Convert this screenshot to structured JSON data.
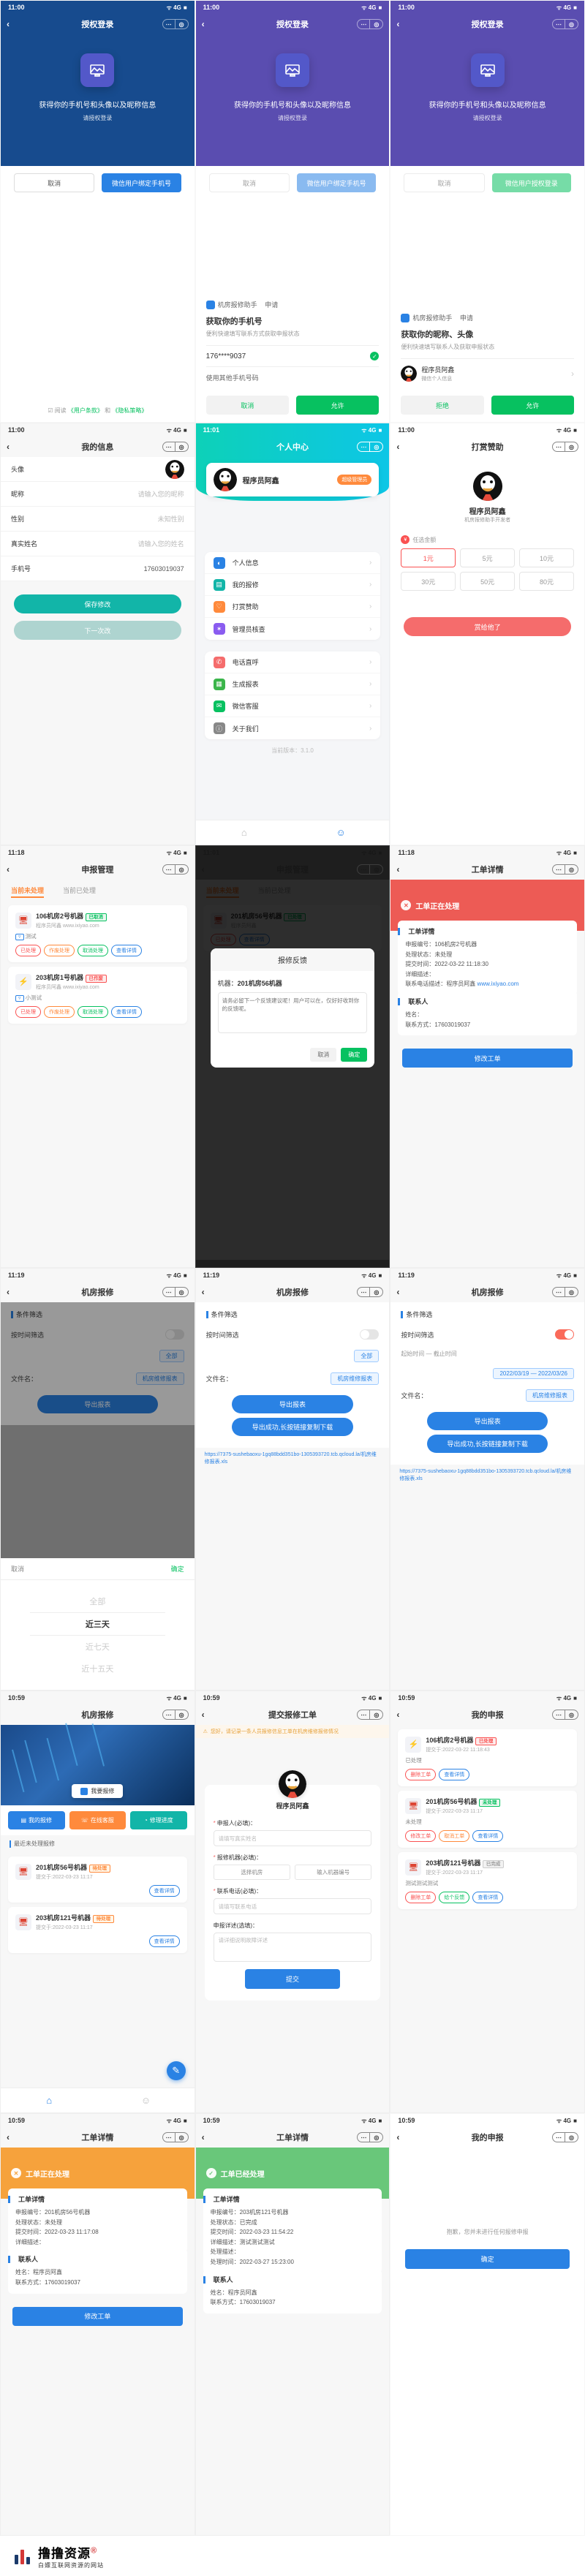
{
  "status": {
    "time1100": "11:00",
    "time1101": "11:01",
    "time1118": "11:18",
    "time1119": "11:19",
    "time1059": "10:59",
    "carrier": "ᯤ 4G",
    "batt": "■"
  },
  "capsule": {
    "dots": "⋯",
    "ring": "◎"
  },
  "back_icon": "‹",
  "auth": {
    "title": "授权登录",
    "headline": "获得你的手机号和头像以及昵称信息",
    "sub": "请授权登录",
    "cancel": "取消",
    "bind": "微信用户绑定手机号",
    "terms_pre": "☑ 阅读",
    "terms_user": "《用户条款》",
    "terms_and": "和",
    "terms_priv": "《隐私策略》",
    "app": "机房报修助手",
    "apply": "申请",
    "get_phone": "获取你的手机号",
    "phone_hint": "便利快速填写联系方式获取申报状态",
    "phone_masked": "176****9037",
    "use_other": "使用其他手机号码",
    "deny": "取消",
    "allow": "允许",
    "get_profile": "获取你的昵称、头像",
    "profile_hint": "便利快速填写联系人及获取申报状态",
    "nickname": "程序员阿鑫",
    "wx_profile": "微信个人信息",
    "edit_link": "›",
    "deny2": "拒绝",
    "allow2": "允许"
  },
  "profile": {
    "title": "我的信息",
    "avatar_lab": "头像",
    "nick_lab": "昵称",
    "nick_ph": "请输入您的昵称",
    "gender_lab": "性别",
    "gender_ph": "未知性别",
    "name_lab": "真实姓名",
    "name_ph": "请输入您的姓名",
    "phone_lab": "手机号",
    "phone_val": "17603019037",
    "save": "保存修改",
    "next": "下一次改"
  },
  "center": {
    "title": "个人中心",
    "name": "程序员阿鑫",
    "role": "超级管理员",
    "m1": "个人信息",
    "c1": "#2a82e4",
    "m2": "我的报修",
    "c2": "#12b5a8",
    "m3": "打赏赞助",
    "c3": "#ff8a3c",
    "m4": "管理员核查",
    "c4": "#8a5cf0",
    "m5": "电话直呼",
    "c5": "#f56c6c",
    "m6": "生成报表",
    "c6": "#3ab54a",
    "m7": "微信客服",
    "c7": "#07c160",
    "m8": "关于我们",
    "c8": "#555",
    "version": "当前版本：3.1.0"
  },
  "donate": {
    "title": "打赏赞助",
    "name": "程序员阿鑫",
    "sub": "机房报修助手开发者",
    "label": "任选金额",
    "a1": "1元",
    "a2": "5元",
    "a3": "10元",
    "a4": "30元",
    "a5": "50元",
    "a6": "80元",
    "btn": "赏给他了"
  },
  "manage": {
    "title": "申报管理",
    "seg1": "当前未处理",
    "seg2": "当前已处理",
    "t1_title": "106机房2号机器",
    "t1_badge": "已取消",
    "t1_url": "程序员阿鑫 www.ixiyao.com",
    "t1_by": "测试",
    "t2_title": "203机房1号机器",
    "t2_badge": "已作废",
    "t2_url": "程序员阿鑫 www.ixiyao.com",
    "t2_by": "小测试",
    "p_done": "已处理",
    "p_void": "作废处理",
    "p_cancel": "取消处理",
    "p_detail": "查看详情"
  },
  "feedback": {
    "title": "报修反馈",
    "machine_lab": "机器：",
    "machine_val": "201机房56机器",
    "placeholder": "请务必留下一个反馈建议呢！用户可以在，仅好好收到你的反馈呢。",
    "cancel": "取消",
    "ok": "确定"
  },
  "detail": {
    "title": "工单详情",
    "b_red": "工单正在处理",
    "b_green": "工单已经处理",
    "sec1": "工单详情",
    "k1": "申报编号：",
    "v1": "106机房2号机器",
    "k2": "处理状态：",
    "v2": "未处理",
    "k3": "提交时间：",
    "v3": "2022-03-22 11:18:30",
    "k4": "详细描述：",
    "k5": "联系电话描述：",
    "v5a": "程序员阿鑫",
    "v5b": "www.ixiyao.com",
    "sec2": "联系人",
    "k6": "姓名：",
    "k7": "联系方式：",
    "v7": "17603019037",
    "btn": "修改工单",
    "g_k3v": "2022-03-23 11:54:22",
    "g_k5": "处理描述：",
    "g_k6": "处理时间：",
    "g_k6v": "2022-03-27 15:23:00",
    "g_name": "程序员阿鑫"
  },
  "report": {
    "title": "机房报修",
    "filter": "条件筛选",
    "by_time": "按时间筛选",
    "by_time_v": "全部",
    "file": "文件名：",
    "file_v": "机房维修报表",
    "export": "导出报表",
    "tip": "导出成功,长按链接复制下载",
    "link1": "https://7375-sushebaoxu-1gq88bdd351bo-1305393720.tcb.qcloud.la/机房维修报表.xls",
    "date_range": "起始时间 — 截止时间",
    "date_v": "2022/03/19 — 2022/03/26",
    "picker_all": "全部",
    "picker_3": "近三天",
    "picker_7": "近七天",
    "picker_15": "近十五天",
    "cancel": "取消",
    "ok": "确定"
  },
  "repair": {
    "title": "机房报修",
    "search": "我要报修",
    "a1": "我的报修",
    "a2": "在线客服",
    "a3": "修理进度",
    "recent": "最近未处理报修",
    "t1": "201机房56号机器",
    "t1_time": "提交于:2022-03-23 11:17",
    "t2": "203机房121号机器",
    "t2_time": "提交于:2022-03-23 11:17",
    "badge_wait": "待处理"
  },
  "submit": {
    "title": "提交报修工单",
    "tip": "您好，请记录一条人员报修信息工单在机房维修报修情况",
    "name": "程序员阿鑫",
    "f1": "申报人(必填)：",
    "f1ph": "请填写真实姓名",
    "f2": "报修机器(必填)：",
    "f2a": "选择机房",
    "f2b": "输入机器编号",
    "f3": "联系电话(必填)：",
    "f3ph": "请填写联系电话",
    "f4": "申报详述(选填)：",
    "f4ph": "请详细说明故障详述",
    "btn": "提交"
  },
  "mine": {
    "title": "我的申报",
    "t1": "106机房2号机器",
    "t1_time": "提交于:2022-03-22 11:18:43",
    "t1_badge": "已处理",
    "t1_status": "已处理",
    "t2": "201机房56号机器",
    "t2_time": "提交于:2022-03-23 11:17",
    "t2_badge": "未处理",
    "t2_status": "未处理",
    "t3": "203机房121号机器",
    "t3_badge": "已完成",
    "t3_status": "测试测试测试",
    "p_modify": "修改工单",
    "p_cancel": "取消工单",
    "p_detail": "查看详情",
    "p_del": "删除工单",
    "p_fb": "给个反馈"
  },
  "error": {
    "title": "我的申报",
    "msg": "抱歉，您并未进行任何报修申报",
    "btn": "确定"
  },
  "brand": {
    "name": "撸撸资源",
    "reg": "®",
    "slogan": "白嫖互联网资源的网站",
    "right": ""
  }
}
